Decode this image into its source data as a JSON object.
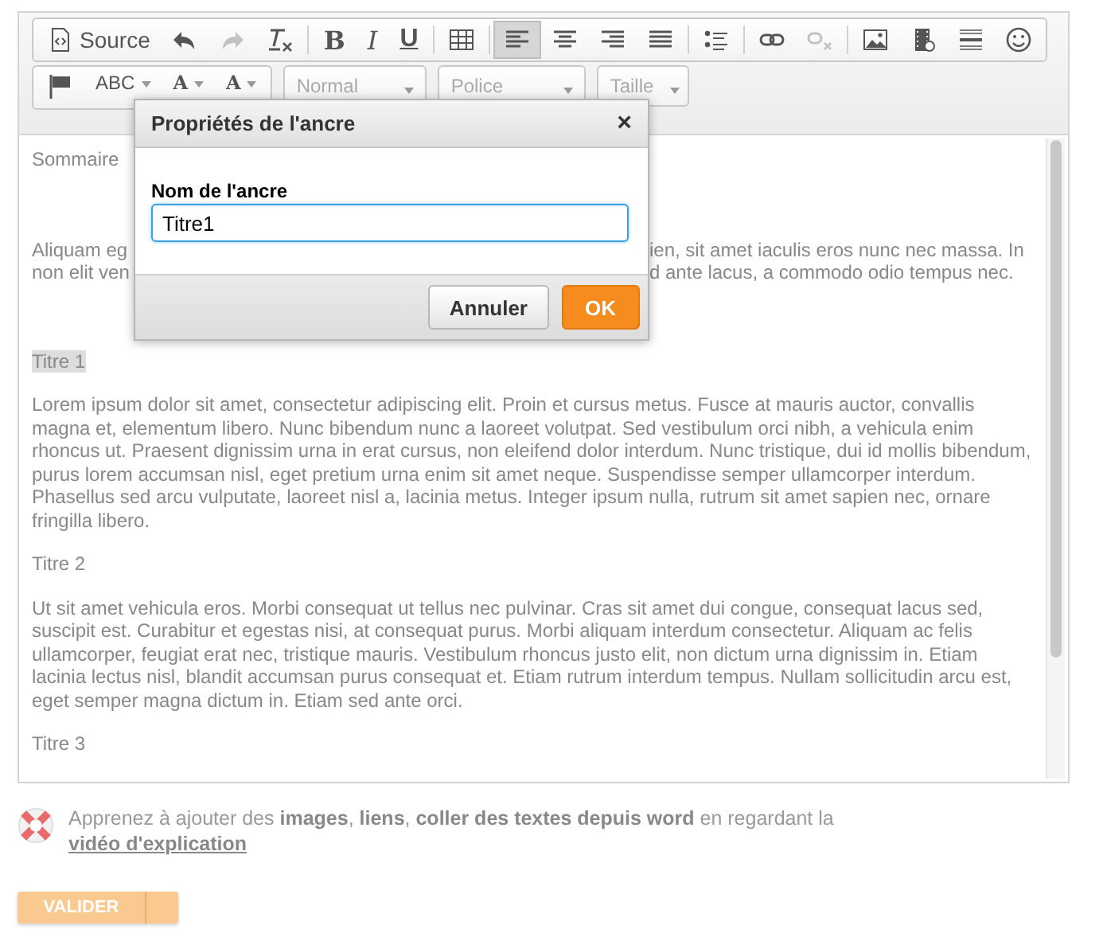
{
  "toolbar": {
    "rows": [
      [
        {
          "kind": "source",
          "label": "Source",
          "disabled": false,
          "selected": false
        },
        {
          "kind": "undo",
          "disabled": false,
          "selected": false
        },
        {
          "kind": "redo",
          "disabled": true,
          "selected": false
        },
        {
          "kind": "clear-format",
          "disabled": false,
          "selected": false
        },
        {
          "kind": "sep"
        },
        {
          "kind": "bold",
          "label": "B",
          "disabled": false,
          "selected": false
        },
        {
          "kind": "italic",
          "label": "I",
          "disabled": false,
          "selected": false
        },
        {
          "kind": "underline",
          "label": "U",
          "disabled": false,
          "selected": false
        },
        {
          "kind": "sep"
        },
        {
          "kind": "table",
          "disabled": false,
          "selected": false
        },
        {
          "kind": "sep"
        },
        {
          "kind": "align-left",
          "disabled": false,
          "selected": true
        },
        {
          "kind": "align-center",
          "disabled": false,
          "selected": false
        },
        {
          "kind": "align-right",
          "disabled": false,
          "selected": false
        },
        {
          "kind": "justify",
          "disabled": false,
          "selected": false
        },
        {
          "kind": "sep"
        },
        {
          "kind": "bullets",
          "disabled": false,
          "selected": false
        },
        {
          "kind": "sep"
        },
        {
          "kind": "link",
          "disabled": false,
          "selected": false
        },
        {
          "kind": "unlink",
          "disabled": true,
          "selected": false
        },
        {
          "kind": "sep"
        },
        {
          "kind": "image",
          "disabled": false,
          "selected": false
        },
        {
          "kind": "video",
          "disabled": false,
          "selected": false
        },
        {
          "kind": "rule",
          "disabled": false,
          "selected": false
        },
        {
          "kind": "smiley",
          "disabled": false,
          "selected": false
        }
      ],
      [
        {
          "kind": "flag",
          "disabled": false,
          "selected": false
        },
        {
          "kind": "spell",
          "label": "ABC",
          "disabled": false,
          "selected": false
        },
        {
          "kind": "text-color",
          "label": "A",
          "disabled": false,
          "selected": false
        },
        {
          "kind": "bg-color",
          "label": "A",
          "disabled": false,
          "selected": false
        }
      ]
    ],
    "combos": [
      {
        "label": "Normal"
      },
      {
        "label": "Police"
      },
      {
        "label": "Taille"
      }
    ]
  },
  "content": {
    "heading": "Sommaire",
    "covered_lines": [
      {
        "left": "Aliquam eg",
        "right": "ien, sit amet iaculis eros nunc nec massa. In"
      },
      {
        "left": "non elit ven",
        "right": "d ante lacus, a commodo odio tempus nec."
      }
    ],
    "paragraphs": [
      {
        "text": "Titre 1",
        "highlighted": true
      },
      {
        "text": "Lorem ipsum dolor sit amet, consectetur adipiscing elit. Proin et cursus metus. Fusce at mauris auctor, convallis magna et, elementum libero. Nunc bibendum nunc a laoreet volutpat. Sed vestibulum orci nibh, a vehicula enim rhoncus ut. Praesent dignissim urna in erat cursus, non eleifend dolor interdum. Nunc tristique, dui id mollis bibendum, purus lorem accumsan nisl, eget pretium urna enim sit amet neque. Suspendisse semper ullamcorper interdum. Phasellus sed arcu vulputate, laoreet nisl a, lacinia metus. Integer ipsum nulla, rutrum sit amet sapien nec, ornare fringilla libero.",
        "highlighted": false
      },
      {
        "text": "Titre 2",
        "highlighted": false
      },
      {
        "text": "Ut sit amet vehicula eros. Morbi consequat ut tellus nec pulvinar. Cras sit amet dui congue, consequat lacus sed, suscipit est. Curabitur et egestas nisi, at consequat purus. Morbi aliquam interdum consectetur. Aliquam ac felis ullamcorper, feugiat erat nec, tristique mauris. Vestibulum rhoncus justo elit, non dictum urna dignissim in. Etiam lacinia lectus nisl, blandit accumsan purus consequat et. Etiam rutrum interdum tempus. Nullam sollicitudin arcu est, eget semper magna dictum in. Etiam sed ante orci.",
        "highlighted": false
      },
      {
        "text": "Titre 3",
        "highlighted": false
      }
    ]
  },
  "dialog": {
    "title": "Propriétés de l'ancre",
    "close": "×",
    "field_label": "Nom de l'ancre",
    "value": "Titre1",
    "buttons": [
      {
        "label": "Annuler",
        "kind": "secondary"
      },
      {
        "label": "OK",
        "kind": "primary"
      }
    ]
  },
  "help": {
    "text": "Apprenez à ajouter des **images**, **liens**, **coller des textes depuis word** en regardant la",
    "link": "vidéo d'explication"
  },
  "submit": {
    "label": "VALIDER",
    "disabled": true
  }
}
